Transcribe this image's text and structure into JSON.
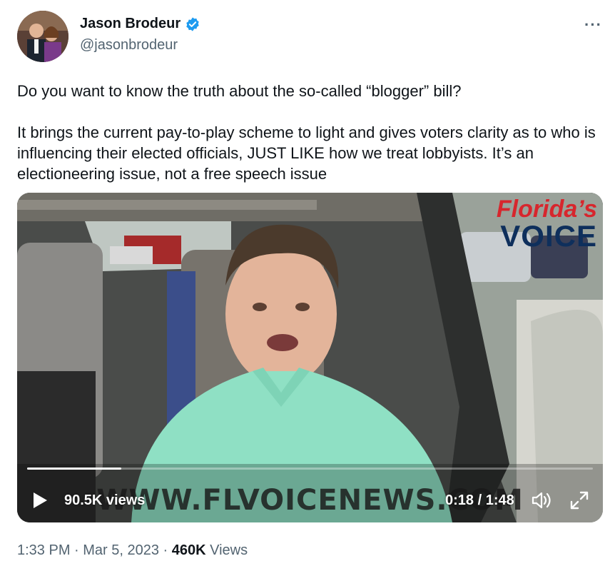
{
  "author": {
    "display_name": "Jason Brodeur",
    "handle": "@jasonbrodeur",
    "verified": true,
    "verified_color": "#1d9bf0"
  },
  "tweet": {
    "paragraphs": [
      "Do you want to know the truth about the so-called “blogger” bill?",
      "It brings the current pay-to-play scheme to light and gives voters clarity as to who is influencing their elected officials, JUST LIKE how we treat lobbyists. It’s an electioneering issue, not a free speech issue"
    ]
  },
  "video": {
    "brand_top": "Florida’s",
    "brand_bottom": "VOICE",
    "watermark": "WWW.FLVOICENEWS.COM",
    "views": "90.5K views",
    "time": "0:18 / 1:48",
    "progress": 0.167
  },
  "footer": {
    "timestamp": "1:33 PM · Mar 5, 2023 · ",
    "view_count": "460K",
    "views_label": " Views"
  },
  "icons": {
    "more": "more-options-icon",
    "verified": "verified-badge-icon",
    "play": "play-icon",
    "volume": "volume-icon",
    "fullscreen": "fullscreen-icon"
  }
}
